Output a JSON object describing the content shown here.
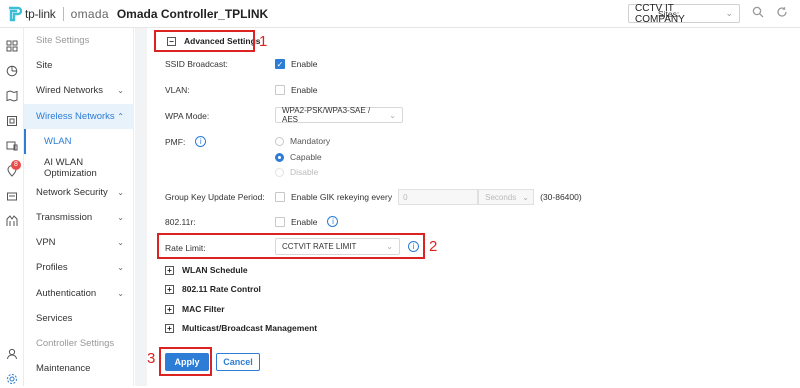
{
  "header": {
    "brand": "tp-link",
    "product": "omada",
    "app_title": "Omada Controller_TPLINK",
    "sites_label": "Sites:",
    "site_value": "CCTV IT COMPANY"
  },
  "rail": {
    "badge": "8"
  },
  "sidebar": {
    "items": [
      {
        "label": "Site Settings"
      },
      {
        "label": "Site"
      },
      {
        "label": "Wired Networks"
      },
      {
        "label": "Wireless Networks"
      },
      {
        "label": "WLAN"
      },
      {
        "label": "AI WLAN Optimization"
      },
      {
        "label": "Network Security"
      },
      {
        "label": "Transmission"
      },
      {
        "label": "VPN"
      },
      {
        "label": "Profiles"
      },
      {
        "label": "Authentication"
      },
      {
        "label": "Services"
      },
      {
        "label": "Controller Settings"
      },
      {
        "label": "Maintenance"
      }
    ]
  },
  "form": {
    "advanced_title": "Advanced Settings",
    "ssid_label": "SSID Broadcast:",
    "ssid_opt": "Enable",
    "vlan_label": "VLAN:",
    "vlan_opt": "Enable",
    "wpa_label": "WPA Mode:",
    "wpa_value": "WPA2-PSK/WPA3-SAE / AES",
    "pmf_label": "PMF:",
    "pmf_options": [
      "Mandatory",
      "Capable",
      "Disable"
    ],
    "gk_label": "Group Key Update Period:",
    "gk_opt": "Enable GIK rekeying every",
    "gk_value": "0",
    "gk_unit": "Seconds",
    "gk_range": "(30-86400)",
    "r80211_label": "802.11r:",
    "r80211_opt": "Enable",
    "rate_label": "Rate Limit:",
    "rate_value": "CCTVIT RATE LIMIT",
    "sections": [
      "WLAN Schedule",
      "802.11 Rate Control",
      "MAC Filter",
      "Multicast/Broadcast Management"
    ]
  },
  "buttons": {
    "apply": "Apply",
    "cancel": "Cancel"
  },
  "annotations": [
    "1",
    "2",
    "3"
  ],
  "colors": {
    "accent": "#2d7cd6",
    "annotation": "#dd2222"
  }
}
